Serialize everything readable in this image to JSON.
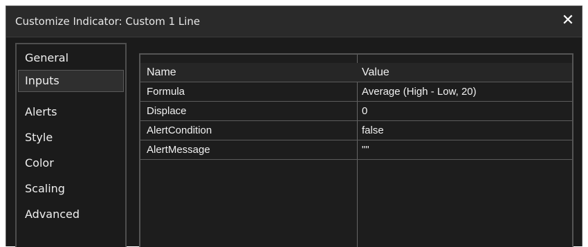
{
  "dialog": {
    "title": "Customize Indicator: Custom 1 Line",
    "close_glyph": "✕"
  },
  "sidebar": {
    "items": [
      {
        "label": "General",
        "selected": false
      },
      {
        "label": "Inputs",
        "selected": true
      },
      {
        "label": "Alerts",
        "selected": false
      },
      {
        "label": "Style",
        "selected": false
      },
      {
        "label": "Color",
        "selected": false
      },
      {
        "label": "Scaling",
        "selected": false
      },
      {
        "label": "Advanced",
        "selected": false
      }
    ]
  },
  "inputs_table": {
    "columns": [
      "Name",
      "Value"
    ],
    "rows": [
      {
        "name": "Formula",
        "value": "Average (High - Low, 20)"
      },
      {
        "name": "Displace",
        "value": "0"
      },
      {
        "name": "AlertCondition",
        "value": "false"
      },
      {
        "name": "AlertMessage",
        "value": "\"\""
      }
    ]
  },
  "colors": {
    "background": "#1b1b1b",
    "titlebar": "#2a2a2a",
    "text": "#efefef",
    "grid": "#5c5c5c"
  }
}
